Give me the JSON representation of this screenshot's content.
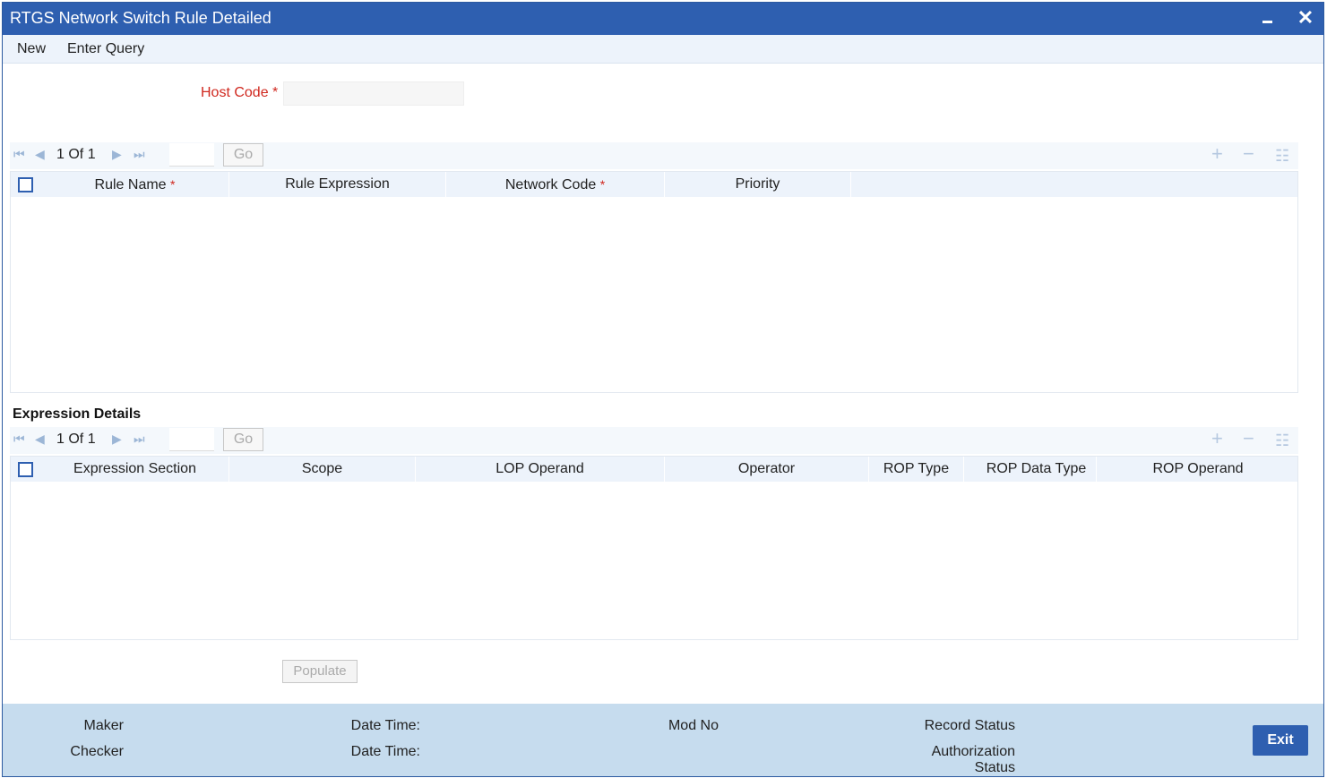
{
  "window": {
    "title": "RTGS Network Switch Rule Detailed"
  },
  "menu": {
    "new": "New",
    "enter_query": "Enter Query"
  },
  "host": {
    "label": "Host Code",
    "required_mark": "*",
    "value": ""
  },
  "rules_grid": {
    "pager": {
      "current": "1",
      "of_label": "Of",
      "total": "1"
    },
    "go_label": "Go",
    "columns": [
      "Rule Name",
      "Rule Expression",
      "Network Code",
      "Priority"
    ],
    "required_mark": "*",
    "rows": []
  },
  "expression_section": {
    "title": "Expression Details",
    "pager": {
      "current": "1",
      "of_label": "Of",
      "total": "1"
    },
    "go_label": "Go",
    "columns": [
      "Expression Section",
      "Scope",
      "LOP Operand",
      "Operator",
      "ROP Type",
      "ROP Data Type",
      "ROP Operand"
    ],
    "rows": []
  },
  "populate_label": "Populate",
  "footer": {
    "maker": "Maker",
    "checker": "Checker",
    "date_time_1": "Date Time:",
    "date_time_2": "Date Time:",
    "mod_no": "Mod No",
    "record_status": "Record Status",
    "authorization": "Authorization",
    "status": "Status",
    "exit_label": "Exit"
  },
  "colors": {
    "titlebar": "#2e5fb0",
    "required": "#d0281f",
    "footer": "#c6dcee",
    "header_row": "#edf3fb"
  },
  "icons": [
    "minimize-icon",
    "close-icon",
    "first-page-icon",
    "previous-page-icon",
    "next-page-icon",
    "last-page-icon",
    "add-row-icon",
    "delete-row-icon",
    "single-view-icon"
  ]
}
